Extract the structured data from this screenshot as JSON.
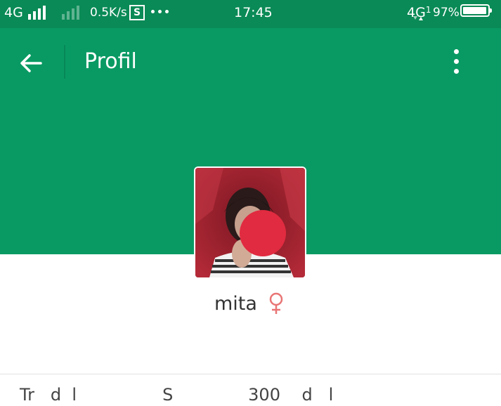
{
  "status_bar": {
    "network_left": "4G",
    "speed": "0.5K/s",
    "s_badge": "S",
    "time": "17:45",
    "network_right": "4G",
    "network_right_sub": "1",
    "battery": "97%",
    "battery_level": 0.97
  },
  "app_bar": {
    "title": "Profil",
    "back_icon": "arrow-left-icon",
    "menu_icon": "more-vertical-icon"
  },
  "profile": {
    "name": "mita",
    "gender_icon": "female-icon",
    "gender_color": "#e97575"
  },
  "colors": {
    "header": "#099a63",
    "status_bar": "#0a8a56",
    "avatar_overlay": "#e12b40"
  },
  "bottom": {
    "partial_text": "Tr   d  l                S              300    d   l"
  }
}
